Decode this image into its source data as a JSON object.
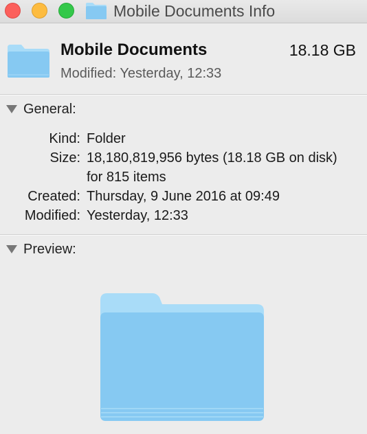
{
  "window": {
    "title": "Mobile Documents Info"
  },
  "header": {
    "name": "Mobile Documents",
    "size": "18.18 GB",
    "modified_label": "Modified:",
    "modified_value": "Yesterday, 12:33",
    "icon": "folder-icon"
  },
  "general": {
    "title": "General:",
    "rows": [
      {
        "label": "Kind:",
        "value": "Folder"
      },
      {
        "label": "Size:",
        "value": "18,180,819,956 bytes (18.18 GB on disk) for 815 items"
      },
      {
        "label": "Created:",
        "value": "Thursday, 9 June 2016 at 09:49"
      },
      {
        "label": "Modified:",
        "value": "Yesterday, 12:33"
      }
    ]
  },
  "preview": {
    "title": "Preview:",
    "icon": "folder-icon"
  },
  "colors": {
    "folder_light": "#a9dcf8",
    "folder_main": "#86c9f2",
    "close": "#fc605c",
    "minimize": "#fdbc40",
    "zoom": "#34c84a"
  }
}
